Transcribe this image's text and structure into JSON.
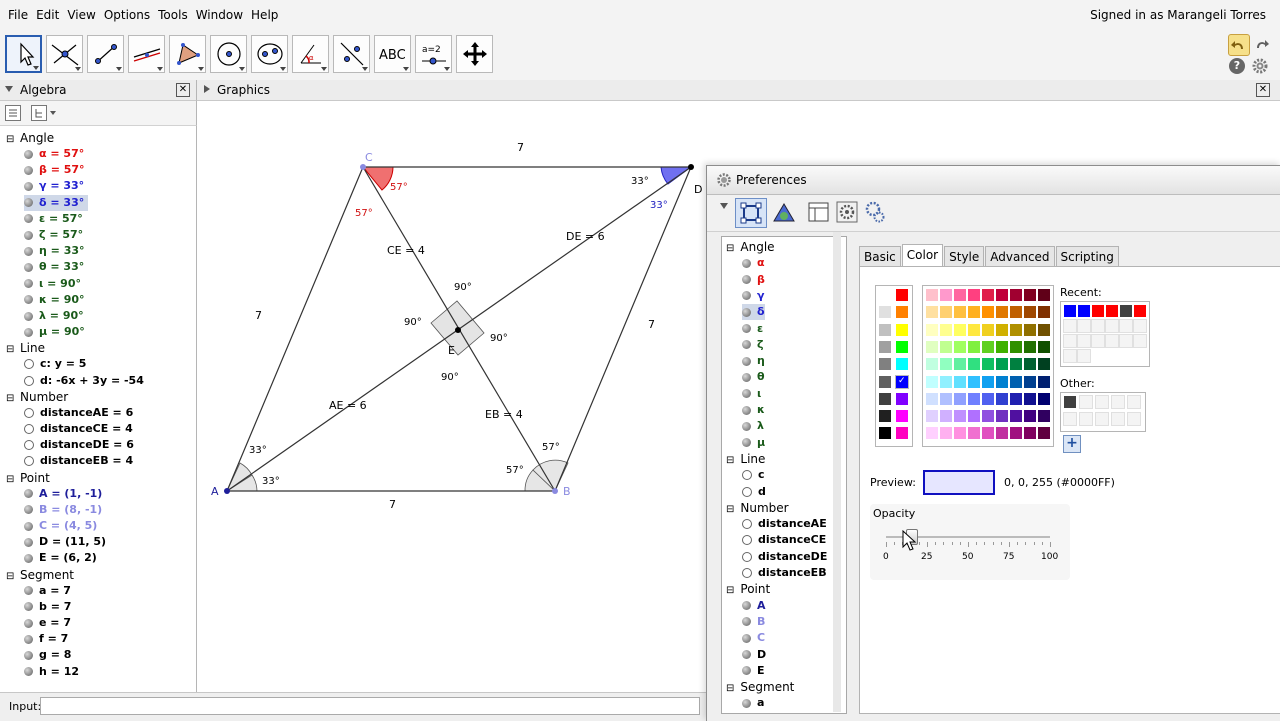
{
  "menubar": {
    "items": [
      "File",
      "Edit",
      "View",
      "Options",
      "Tools",
      "Window",
      "Help"
    ],
    "signed_in": "Signed in as Marangeli Torres"
  },
  "toolbar": {
    "tools": [
      "move-tool",
      "point-tool",
      "line-tool",
      "perpendicular-line-tool",
      "polygon-tool",
      "circle-tool",
      "conic-tool",
      "angle-tool",
      "reflect-tool",
      "text-tool",
      "slider-tool",
      "move-graphics-view-tool"
    ],
    "text_tool_label": "ABC",
    "slider_tool_label": "a=2"
  },
  "algebra": {
    "title": "Algebra",
    "groups": [
      {
        "name": "Angle",
        "items": [
          {
            "text": "α = 57°",
            "color": "#e01010",
            "on": true
          },
          {
            "text": "β = 57°",
            "color": "#e01010",
            "on": true
          },
          {
            "text": "γ = 33°",
            "color": "#2020d0",
            "on": true
          },
          {
            "text": "δ = 33°",
            "color": "#2020d0",
            "on": true,
            "selected": true
          },
          {
            "text": "ε = 57°",
            "color": "#1a5a1a",
            "on": true
          },
          {
            "text": "ζ = 57°",
            "color": "#1a5a1a",
            "on": true
          },
          {
            "text": "η = 33°",
            "color": "#1a5a1a",
            "on": true
          },
          {
            "text": "θ = 33°",
            "color": "#1a5a1a",
            "on": true
          },
          {
            "text": "ι = 90°",
            "color": "#1a5a1a",
            "on": true
          },
          {
            "text": "κ = 90°",
            "color": "#1a5a1a",
            "on": true
          },
          {
            "text": "λ = 90°",
            "color": "#1a5a1a",
            "on": true
          },
          {
            "text": "μ = 90°",
            "color": "#1a5a1a",
            "on": true
          }
        ]
      },
      {
        "name": "Line",
        "items": [
          {
            "text": "c: y = 5",
            "color": "#000000",
            "on": false
          },
          {
            "text": "d: -6x + 3y = -54",
            "color": "#000000",
            "on": false
          }
        ]
      },
      {
        "name": "Number",
        "items": [
          {
            "text": "distanceAE = 6",
            "color": "#000000",
            "on": false
          },
          {
            "text": "distanceCE = 4",
            "color": "#000000",
            "on": false
          },
          {
            "text": "distanceDE = 6",
            "color": "#000000",
            "on": false
          },
          {
            "text": "distanceEB = 4",
            "color": "#000000",
            "on": false
          }
        ]
      },
      {
        "name": "Point",
        "items": [
          {
            "text": "A = (1, -1)",
            "color": "#1e1e9a",
            "on": true
          },
          {
            "text": "B = (8, -1)",
            "color": "#8a8ae0",
            "on": true
          },
          {
            "text": "C = (4, 5)",
            "color": "#8a8ae0",
            "on": true
          },
          {
            "text": "D = (11, 5)",
            "color": "#000000",
            "on": true
          },
          {
            "text": "E = (6, 2)",
            "color": "#000000",
            "on": true
          }
        ]
      },
      {
        "name": "Segment",
        "items": [
          {
            "text": "a = 7",
            "color": "#000000",
            "on": true
          },
          {
            "text": "b = 7",
            "color": "#000000",
            "on": true
          },
          {
            "text": "e = 7",
            "color": "#000000",
            "on": true
          },
          {
            "text": "f = 7",
            "color": "#000000",
            "on": true
          },
          {
            "text": "g = 8",
            "color": "#000000",
            "on": true
          },
          {
            "text": "h = 12",
            "color": "#000000",
            "on": true
          }
        ]
      }
    ]
  },
  "graphics": {
    "title": "Graphics",
    "labels": {
      "A": "A",
      "B": "B",
      "C": "C",
      "D": "D",
      "E": "E",
      "side_top": "7",
      "side_left": "7",
      "side_right": "7",
      "side_bottom": "7",
      "ce": "CE = 4",
      "de": "DE = 6",
      "ae": "AE = 6",
      "eb": "EB = 4",
      "ang_c_in": "57°",
      "ang_c_out": "57°",
      "ang_d_1": "33°",
      "ang_d_2": "33°",
      "ang_a_1": "33°",
      "ang_a_2": "33°",
      "ang_b_1": "57°",
      "ang_b_2": "57°",
      "ang_e_top": "90°",
      "ang_e_left": "90°",
      "ang_e_right": "90°",
      "ang_e_bottom": "90°"
    }
  },
  "input": {
    "label": "Input:",
    "value": ""
  },
  "preferences": {
    "title": "Preferences",
    "tree": [
      {
        "type": "group",
        "text": "Angle"
      },
      {
        "type": "item",
        "text": "α",
        "color": "#e01010",
        "on": true
      },
      {
        "type": "item",
        "text": "β",
        "color": "#e01010",
        "on": true
      },
      {
        "type": "item",
        "text": "γ",
        "color": "#2020d0",
        "on": true
      },
      {
        "type": "item",
        "text": "δ",
        "color": "#2020d0",
        "on": true,
        "selected": true
      },
      {
        "type": "item",
        "text": "ε",
        "color": "#1a5a1a",
        "on": true
      },
      {
        "type": "item",
        "text": "ζ",
        "color": "#1a5a1a",
        "on": true
      },
      {
        "type": "item",
        "text": "η",
        "color": "#1a5a1a",
        "on": true
      },
      {
        "type": "item",
        "text": "θ",
        "color": "#1a5a1a",
        "on": true
      },
      {
        "type": "item",
        "text": "ι",
        "color": "#1a5a1a",
        "on": true
      },
      {
        "type": "item",
        "text": "κ",
        "color": "#1a5a1a",
        "on": true
      },
      {
        "type": "item",
        "text": "λ",
        "color": "#1a5a1a",
        "on": true
      },
      {
        "type": "item",
        "text": "μ",
        "color": "#1a5a1a",
        "on": true
      },
      {
        "type": "group",
        "text": "Line"
      },
      {
        "type": "item",
        "text": "c",
        "color": "#000000",
        "on": false
      },
      {
        "type": "item",
        "text": "d",
        "color": "#000000",
        "on": false
      },
      {
        "type": "group",
        "text": "Number"
      },
      {
        "type": "item",
        "text": "distanceAE",
        "color": "#000000",
        "on": false
      },
      {
        "type": "item",
        "text": "distanceCE",
        "color": "#000000",
        "on": false
      },
      {
        "type": "item",
        "text": "distanceDE",
        "color": "#000000",
        "on": false
      },
      {
        "type": "item",
        "text": "distanceEB",
        "color": "#000000",
        "on": false
      },
      {
        "type": "group",
        "text": "Point"
      },
      {
        "type": "item",
        "text": "A",
        "color": "#1e1e9a",
        "on": true
      },
      {
        "type": "item",
        "text": "B",
        "color": "#8a8ae0",
        "on": true
      },
      {
        "type": "item",
        "text": "C",
        "color": "#8a8ae0",
        "on": true
      },
      {
        "type": "item",
        "text": "D",
        "color": "#000000",
        "on": true
      },
      {
        "type": "item",
        "text": "E",
        "color": "#000000",
        "on": true
      },
      {
        "type": "group",
        "text": "Segment"
      },
      {
        "type": "item",
        "text": "a",
        "color": "#000000",
        "on": true
      }
    ],
    "tabs": [
      "Basic",
      "Color",
      "Style",
      "Advanced",
      "Scripting"
    ],
    "active_tab": "Color",
    "recent_label": "Recent:",
    "other_label": "Other:",
    "preview_label": "Preview:",
    "preview_value": "0, 0, 255 (#0000FF)",
    "preview_color": "#e6e6ff",
    "opacity_label": "Opacity",
    "opacity_value": 0.15,
    "opacity_ticks": [
      "0",
      "25",
      "50",
      "75",
      "100"
    ],
    "recent_colors": [
      "#0000ff",
      "#0000ff",
      "#ff0000",
      "#ff0000",
      "#404040",
      "#ff0000"
    ],
    "other_colors": [
      "#404040"
    ],
    "basic_colors": [
      "#ffffff",
      "#ff0000",
      "#e0e0e0",
      "#ff8000",
      "#c0c0c0",
      "#ffff00",
      "#a0a0a0",
      "#00ff00",
      "#808080",
      "#00ffff",
      "#606060",
      "#0000ff",
      "#404040",
      "#8000ff",
      "#202020",
      "#ff00ff",
      "#000000",
      "#ff00c0"
    ],
    "palette_colors": [
      [
        "#ffc0cb",
        "#ff99cc",
        "#ff66a0",
        "#ff4080",
        "#e0204a",
        "#c0003a",
        "#a00030",
        "#800020",
        "#600018"
      ],
      [
        "#ffe0a0",
        "#ffd070",
        "#ffc040",
        "#ffb020",
        "#ff9000",
        "#e07800",
        "#c06000",
        "#a04800",
        "#803000"
      ],
      [
        "#ffffc0",
        "#ffff90",
        "#ffff60",
        "#ffe840",
        "#f0d020",
        "#d0b000",
        "#b09000",
        "#907000",
        "#705000"
      ],
      [
        "#e0ffc0",
        "#c0ff90",
        "#a0ff60",
        "#80f040",
        "#60d020",
        "#40b000",
        "#309000",
        "#207000",
        "#105000"
      ],
      [
        "#c0ffe0",
        "#90ffc0",
        "#60f0a0",
        "#30e080",
        "#10c060",
        "#00a050",
        "#008040",
        "#006030",
        "#004020"
      ],
      [
        "#c0ffff",
        "#90f0ff",
        "#60e0ff",
        "#30c0ff",
        "#10a0f0",
        "#0080d0",
        "#0060b0",
        "#004090",
        "#002070"
      ],
      [
        "#d0e0ff",
        "#b0c0ff",
        "#90a0ff",
        "#7080ff",
        "#5060f0",
        "#3040d0",
        "#2020b0",
        "#101090",
        "#000070"
      ],
      [
        "#e0d0ff",
        "#d0b0ff",
        "#c090ff",
        "#b070ff",
        "#9050e0",
        "#7030c0",
        "#5010a0",
        "#400080",
        "#300060"
      ],
      [
        "#ffd0ff",
        "#ffb0f0",
        "#ff90e0",
        "#f070d0",
        "#e050c0",
        "#c030a0",
        "#a01080",
        "#800060",
        "#600040"
      ]
    ]
  }
}
